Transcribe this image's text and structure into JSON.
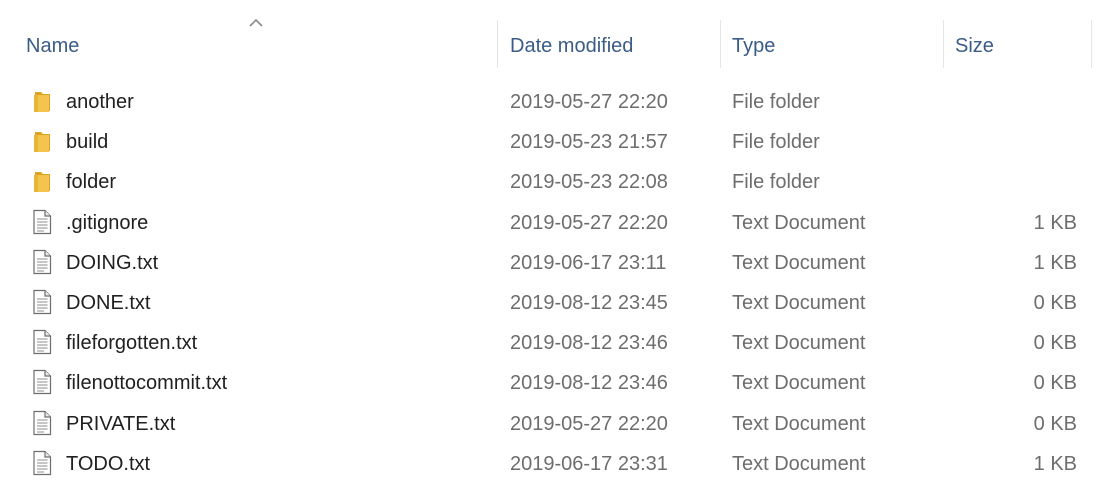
{
  "columns": {
    "name": "Name",
    "date_modified": "Date modified",
    "type": "Type",
    "size": "Size"
  },
  "sort": {
    "column": "name",
    "direction": "ascending",
    "icon": "chevron-up-icon"
  },
  "colors": {
    "header_text": "#3a5c86",
    "name_text": "#202020",
    "meta_text": "#6d6d6d",
    "folder": "#f4c44e",
    "folder_dark": "#d9a520"
  },
  "files": [
    {
      "name": "another",
      "date": "2019-05-27 22:20",
      "type": "File folder",
      "size": "",
      "icon": "folder-icon"
    },
    {
      "name": "build",
      "date": "2019-05-23 21:57",
      "type": "File folder",
      "size": "",
      "icon": "folder-icon"
    },
    {
      "name": "folder",
      "date": "2019-05-23 22:08",
      "type": "File folder",
      "size": "",
      "icon": "folder-icon"
    },
    {
      "name": ".gitignore",
      "date": "2019-05-27 22:20",
      "type": "Text Document",
      "size": "1 KB",
      "icon": "text-document-icon"
    },
    {
      "name": "DOING.txt",
      "date": "2019-06-17 23:11",
      "type": "Text Document",
      "size": "1 KB",
      "icon": "text-document-icon"
    },
    {
      "name": "DONE.txt",
      "date": "2019-08-12 23:45",
      "type": "Text Document",
      "size": "0 KB",
      "icon": "text-document-icon"
    },
    {
      "name": "fileforgotten.txt",
      "date": "2019-08-12 23:46",
      "type": "Text Document",
      "size": "0 KB",
      "icon": "text-document-icon"
    },
    {
      "name": "filenottocommit.txt",
      "date": "2019-08-12 23:46",
      "type": "Text Document",
      "size": "0 KB",
      "icon": "text-document-icon"
    },
    {
      "name": "PRIVATE.txt",
      "date": "2019-05-27 22:20",
      "type": "Text Document",
      "size": "0 KB",
      "icon": "text-document-icon"
    },
    {
      "name": "TODO.txt",
      "date": "2019-06-17 23:31",
      "type": "Text Document",
      "size": "1 KB",
      "icon": "text-document-icon"
    }
  ]
}
